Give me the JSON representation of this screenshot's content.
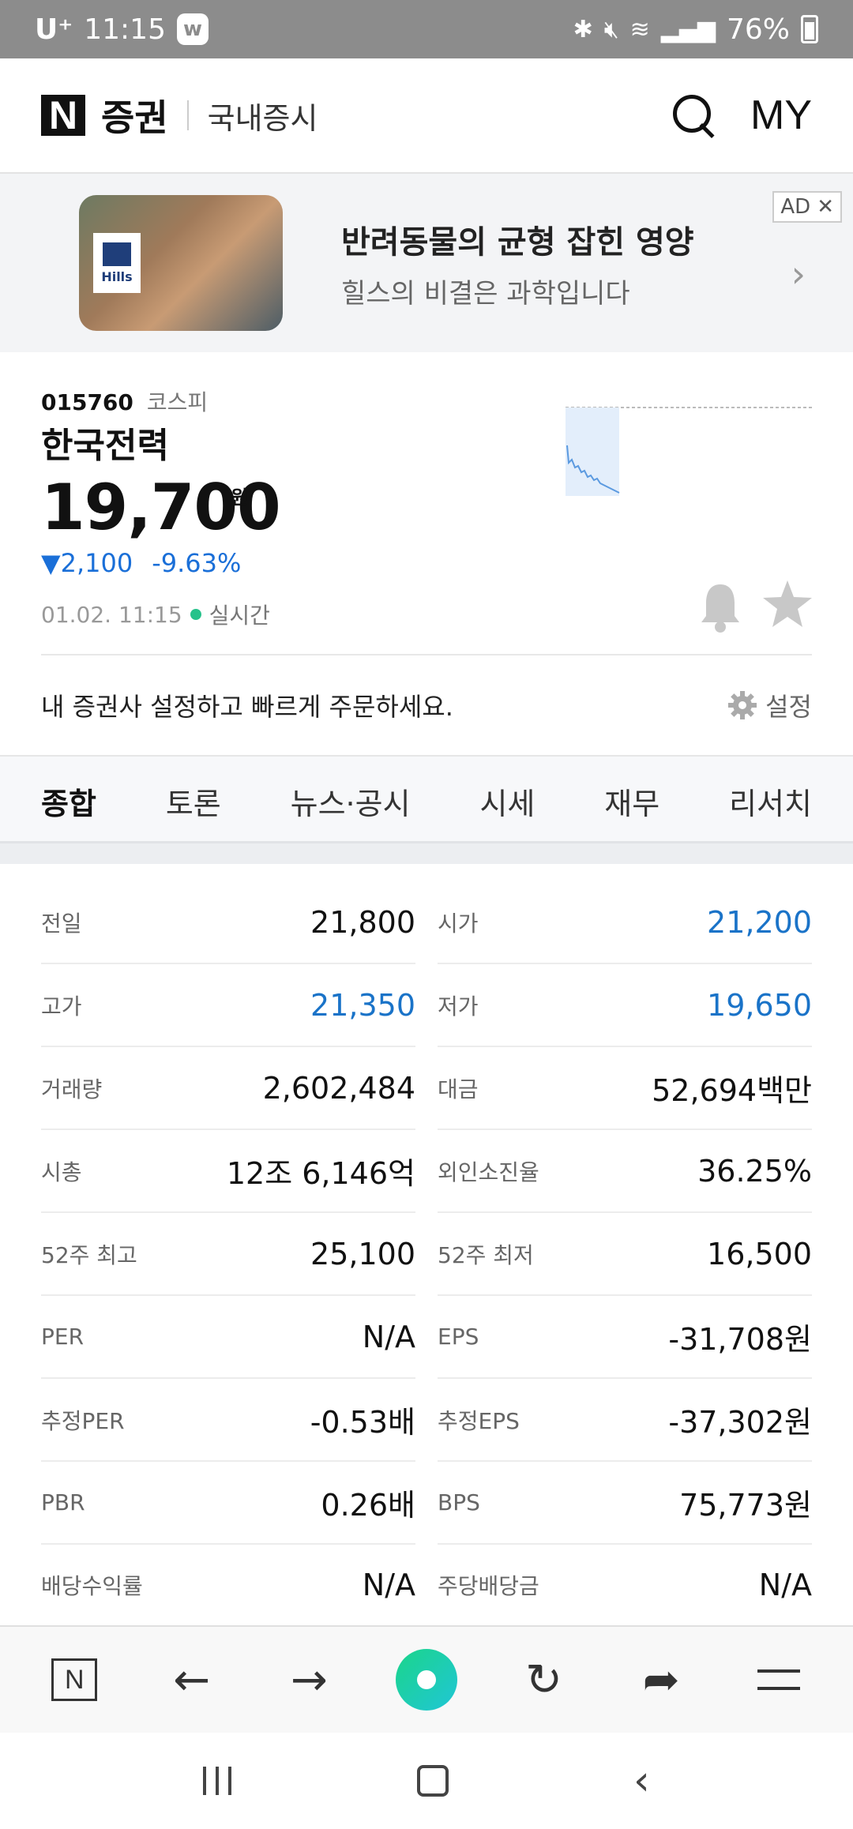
{
  "status": {
    "carrier": "U⁺",
    "time": "11:15",
    "app_badge": "w",
    "battery": "76%"
  },
  "header": {
    "logo": "N",
    "brand": "증권",
    "section": "국내증시",
    "my": "MY"
  },
  "ad": {
    "brand_logo": "Hills",
    "title": "반려동물의 균형 잡힌 영양",
    "subtitle": "힐스의 비결은 과학입니다",
    "badge": "AD",
    "close": "✕"
  },
  "stock": {
    "code": "015760",
    "market": "코스피",
    "name": "한국전력",
    "price": "19,700",
    "unit": "원",
    "change_amount": "2,100",
    "change_percent": "-9.63%",
    "timestamp": "01.02. 11:15",
    "realtime": "실시간",
    "trend_color": "#1a73c8"
  },
  "broker": {
    "text": "내 증권사 설정하고 빠르게 주문하세요.",
    "settings": "설정"
  },
  "tabs": [
    {
      "label": "종합",
      "active": true
    },
    {
      "label": "토론"
    },
    {
      "label": "뉴스·공시"
    },
    {
      "label": "시세"
    },
    {
      "label": "재무"
    },
    {
      "label": "리서치"
    }
  ],
  "stats": {
    "r0": {
      "l1": "전일",
      "v1": "21,800",
      "l2": "시가",
      "v2": "21,200"
    },
    "r1": {
      "l1": "고가",
      "v1": "21,350",
      "l2": "저가",
      "v2": "19,650"
    },
    "r2": {
      "l1": "거래량",
      "v1": "2,602,484",
      "l2": "대금",
      "v2": "52,694백만"
    },
    "r3": {
      "l1": "시총",
      "v1": "12조 6,146억",
      "l2": "외인소진율",
      "v2": "36.25%"
    },
    "r4": {
      "l1": "52주 최고",
      "v1": "25,100",
      "l2": "52주 최저",
      "v2": "16,500"
    },
    "r5": {
      "l1": "PER",
      "v1": "N/A",
      "l2": "EPS",
      "v2": "-31,708원"
    },
    "r6": {
      "l1": "추정PER",
      "v1": "-0.53배",
      "l2": "추정EPS",
      "v2": "-37,302원"
    },
    "r7": {
      "l1": "PBR",
      "v1": "0.26배",
      "l2": "BPS",
      "v2": "75,773원"
    },
    "r8": {
      "l1": "배당수익률",
      "v1": "N/A",
      "l2": "주당배당금",
      "v2": "N/A"
    }
  },
  "browser": {
    "home": "N"
  }
}
